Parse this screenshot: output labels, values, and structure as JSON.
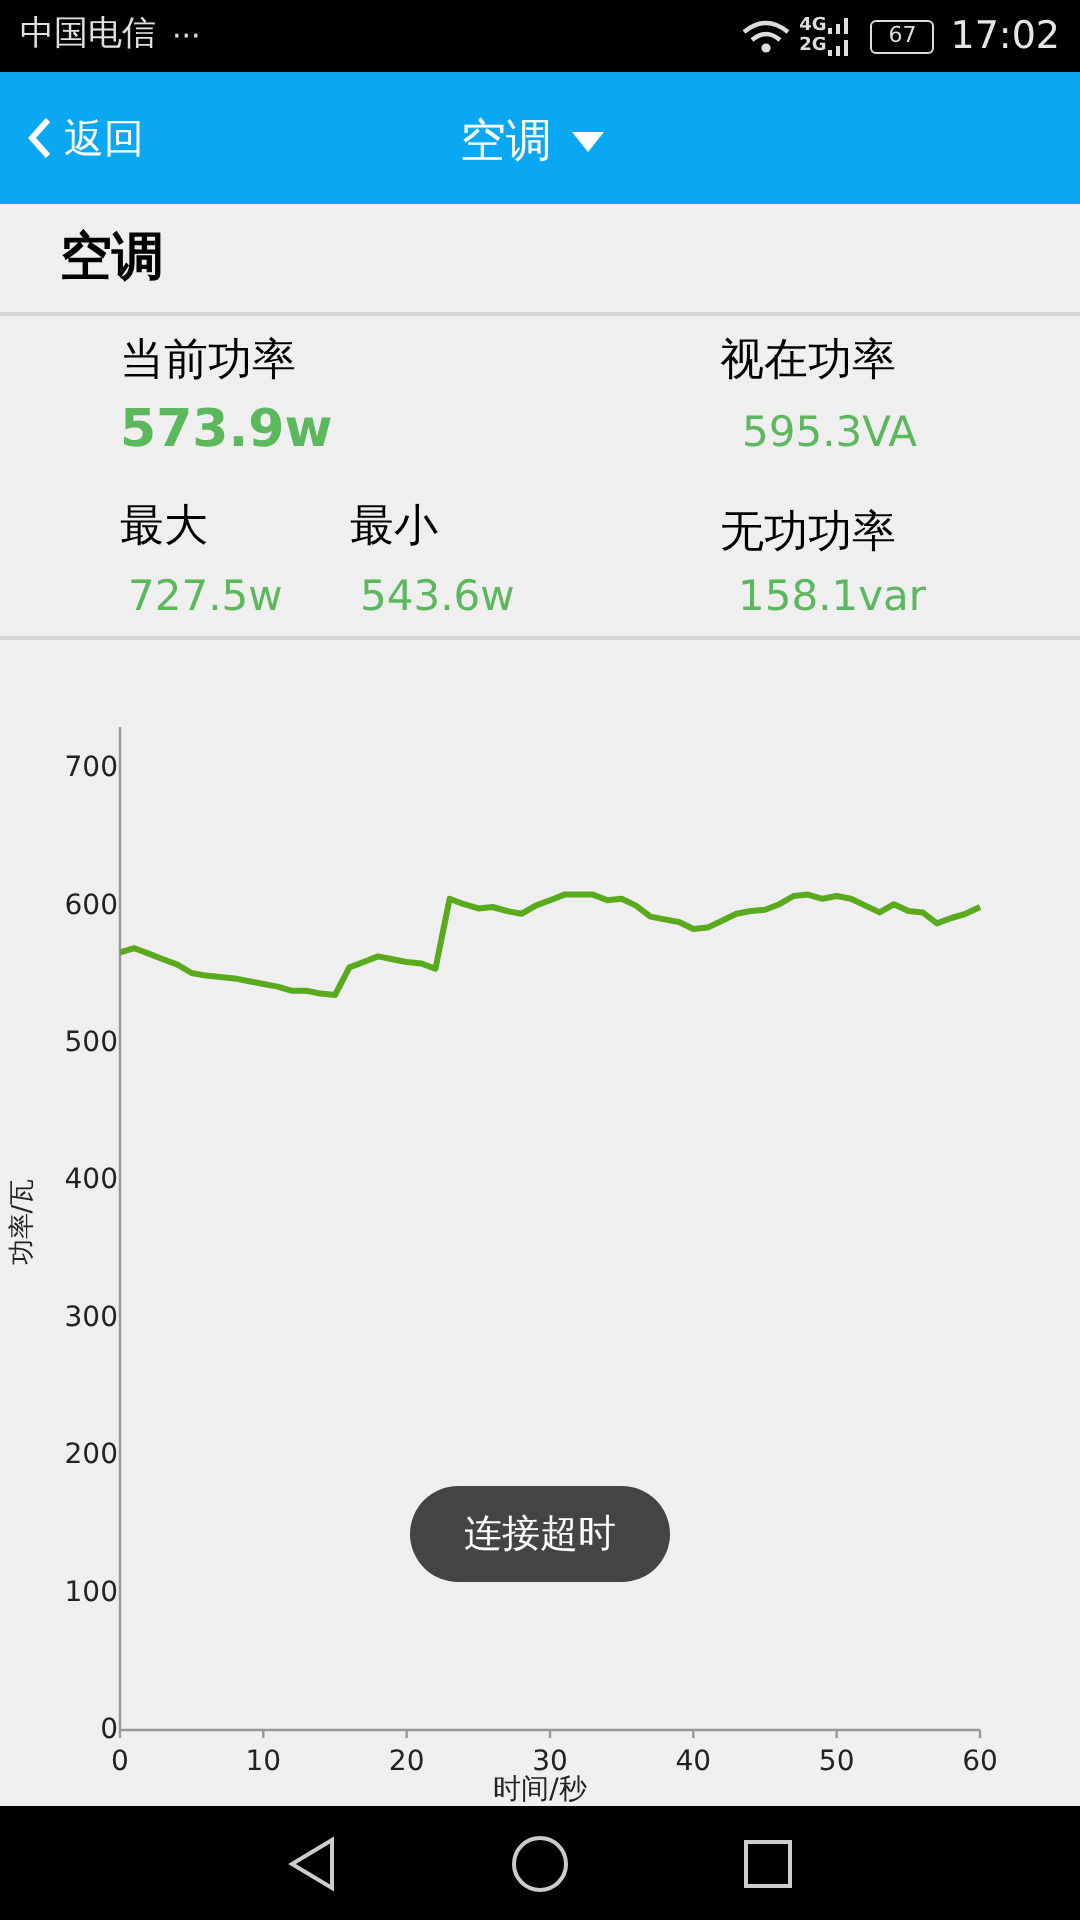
{
  "status_bar": {
    "carrier": "中国电信",
    "more": "···",
    "net_top": "4G",
    "net_bottom": "2G",
    "battery": "67",
    "time": "17:02"
  },
  "app_bar": {
    "back": "返回",
    "title": "空调"
  },
  "device_name": "空调",
  "stats": {
    "current_label": "当前功率",
    "current_value": "573.9w",
    "apparent_label": "视在功率",
    "apparent_value": "595.3VA",
    "max_label": "最大",
    "max_value": "727.5w",
    "min_label": "最小",
    "min_value": "543.6w",
    "reactive_label": "无功功率",
    "reactive_value": "158.1var"
  },
  "chart": {
    "chart_data": {
      "type": "line",
      "xlabel": "时间/秒",
      "ylabel": "功率/瓦",
      "xlim": [
        0,
        60
      ],
      "ylim": [
        0,
        730
      ],
      "xticks": [
        0,
        10,
        20,
        30,
        40,
        50,
        60
      ],
      "yticks": [
        0,
        100,
        200,
        300,
        400,
        500,
        600,
        700
      ],
      "x": [
        0,
        1,
        2,
        3,
        4,
        5,
        6,
        7,
        8,
        9,
        10,
        11,
        12,
        13,
        14,
        15,
        16,
        17,
        18,
        19,
        20,
        21,
        22,
        23,
        24,
        25,
        26,
        27,
        28,
        29,
        30,
        31,
        32,
        33,
        34,
        35,
        36,
        37,
        38,
        39,
        40,
        41,
        42,
        43,
        44,
        45,
        46,
        47,
        48,
        49,
        50,
        51,
        52,
        53,
        54,
        55,
        56,
        57,
        58,
        59,
        60
      ],
      "series": [
        {
          "color": "#5aaa1e",
          "values": [
            566,
            569,
            565,
            561,
            557,
            551,
            549,
            548,
            547,
            545,
            543,
            541,
            538,
            538,
            536,
            535,
            555,
            559,
            563,
            561,
            559,
            558,
            554,
            605,
            601,
            598,
            599,
            596,
            594,
            600,
            604,
            608,
            608,
            608,
            604,
            605,
            600,
            592,
            590,
            588,
            583,
            584,
            589,
            594,
            596,
            597,
            601,
            607,
            608,
            605,
            607,
            605,
            600,
            595,
            601,
            596,
            595,
            587,
            591,
            594,
            599
          ]
        }
      ]
    }
  },
  "toast": "连接超时"
}
